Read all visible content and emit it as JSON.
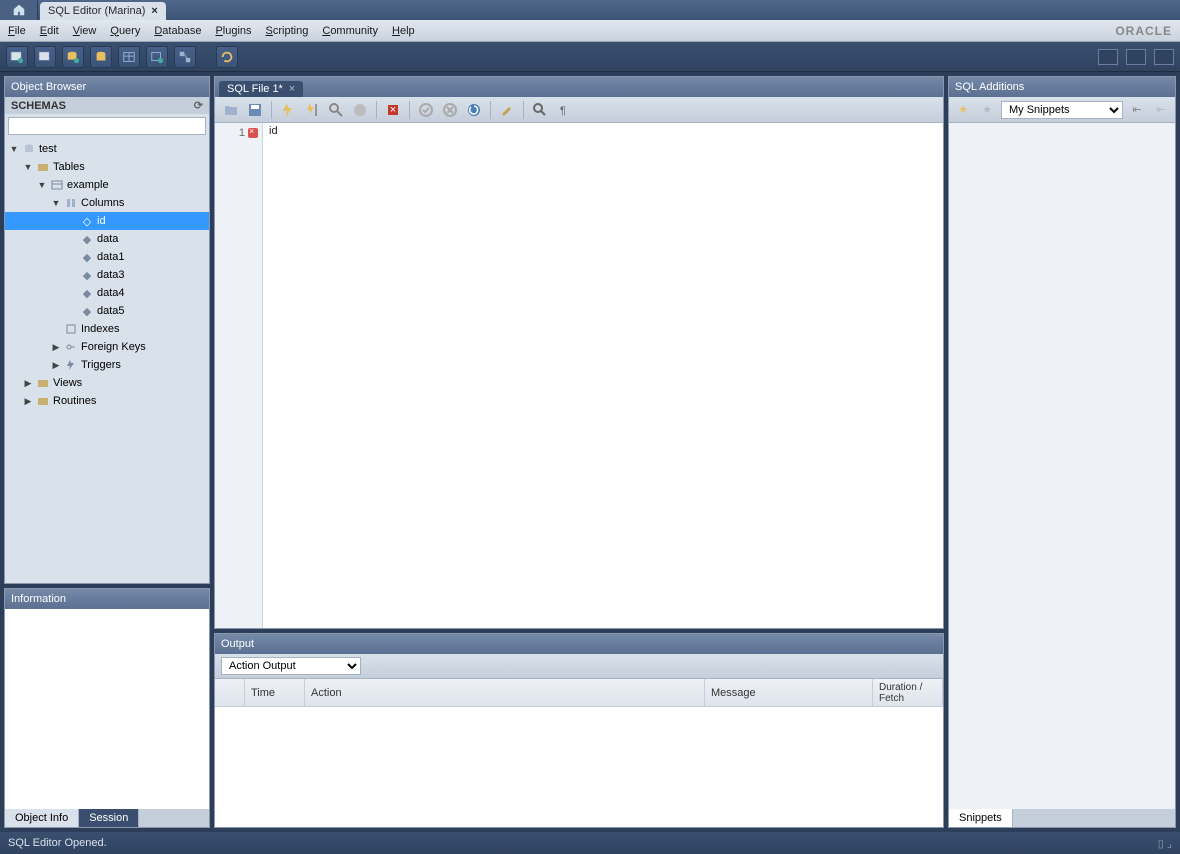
{
  "titlebar": {
    "tab_label": "SQL Editor (Marina)"
  },
  "menu": {
    "file": "File",
    "edit": "Edit",
    "view": "View",
    "query": "Query",
    "database": "Database",
    "plugins": "Plugins",
    "scripting": "Scripting",
    "community": "Community",
    "help": "Help",
    "brand": "ORACLE"
  },
  "object_browser": {
    "title": "Object Browser",
    "schemas_label": "SCHEMAS",
    "search_value": "",
    "tree": {
      "db": "test",
      "tables": "Tables",
      "example": "example",
      "columns": "Columns",
      "cols": [
        "id",
        "data",
        "data1",
        "data3",
        "data4",
        "data5"
      ],
      "indexes": "Indexes",
      "fkeys": "Foreign Keys",
      "triggers": "Triggers",
      "views": "Views",
      "routines": "Routines"
    }
  },
  "information": {
    "title": "Information",
    "tabs": {
      "object_info": "Object Info",
      "session": "Session"
    }
  },
  "editor": {
    "tab_label": "SQL File 1*",
    "line_number": "1",
    "code": "id"
  },
  "output": {
    "title": "Output",
    "selector": "Action Output",
    "columns": {
      "time": "Time",
      "action": "Action",
      "message": "Message",
      "duration": "Duration / Fetch"
    }
  },
  "additions": {
    "title": "SQL Additions",
    "selector": "My Snippets",
    "tab": "Snippets"
  },
  "status": {
    "text": "SQL Editor Opened."
  }
}
